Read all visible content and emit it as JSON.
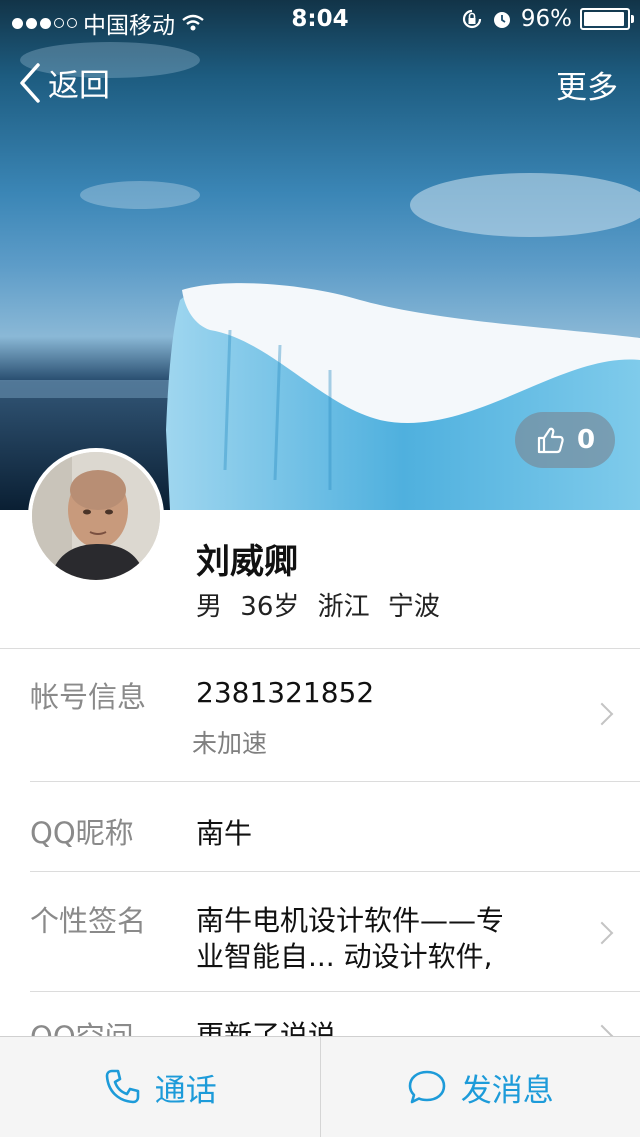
{
  "status_bar": {
    "carrier": "中国移动",
    "time": "8:04",
    "battery_percent": "96%",
    "signal_bars_filled": 3,
    "signal_bars_total": 5
  },
  "nav": {
    "back_label": "返回",
    "more_label": "更多"
  },
  "profile": {
    "like_count": "0",
    "name": "刘威卿",
    "gender": "男",
    "age": "36岁",
    "province": "浙江",
    "city": "宁波"
  },
  "rows": [
    {
      "label": "帐号信息",
      "value": "2381321852",
      "sub": "未加速"
    },
    {
      "label": "QQ昵称",
      "value": "南牛"
    },
    {
      "label": "个性签名",
      "line1": "南牛电机设计软件——专",
      "line2": "业智能自...   动设计软件,"
    },
    {
      "label": "QQ空间",
      "value": "更新了说说"
    }
  ],
  "bottom_bar": {
    "call_label": "通话",
    "message_label": "发消息",
    "accent_color": "#1d9bd9"
  },
  "icons": {
    "back": "chevron-left-icon",
    "like": "thumbs-up-icon",
    "call": "phone-icon",
    "message": "chat-bubble-icon",
    "row_arrow": "chevron-right-icon"
  }
}
